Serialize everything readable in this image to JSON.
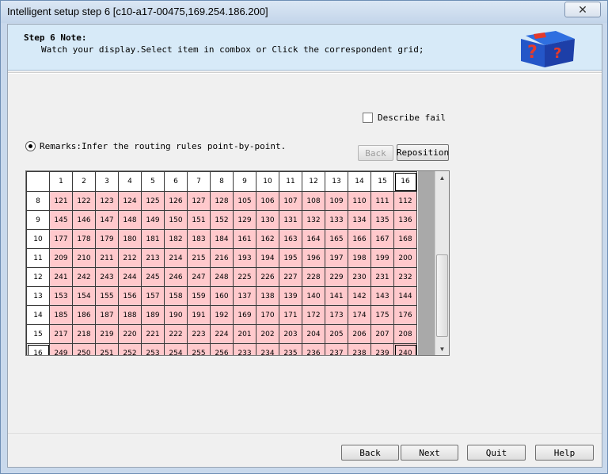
{
  "window": {
    "title": "Intelligent setup step 6 [c10-a17-00475,169.254.186.200]"
  },
  "note": {
    "title": "Step 6 Note:",
    "text": "Watch your display.Select item in combox or Click the correspondent grid;"
  },
  "describe_failure": {
    "label": "Describe fail",
    "checked": false
  },
  "remarks": {
    "label": "Remarks:Infer the routing rules point-by-point.",
    "selected": true
  },
  "grid_buttons": {
    "back_label": "Back",
    "reposition_label": "Reposition"
  },
  "grid": {
    "columns": [
      "1",
      "2",
      "3",
      "4",
      "5",
      "6",
      "7",
      "8",
      "9",
      "10",
      "11",
      "12",
      "13",
      "14",
      "15",
      "16"
    ],
    "rows": [
      {
        "label": "8",
        "cells": [
          "121",
          "122",
          "123",
          "124",
          "125",
          "126",
          "127",
          "128",
          "105",
          "106",
          "107",
          "108",
          "109",
          "110",
          "111",
          "112"
        ]
      },
      {
        "label": "9",
        "cells": [
          "145",
          "146",
          "147",
          "148",
          "149",
          "150",
          "151",
          "152",
          "129",
          "130",
          "131",
          "132",
          "133",
          "134",
          "135",
          "136"
        ]
      },
      {
        "label": "10",
        "cells": [
          "177",
          "178",
          "179",
          "180",
          "181",
          "182",
          "183",
          "184",
          "161",
          "162",
          "163",
          "164",
          "165",
          "166",
          "167",
          "168"
        ]
      },
      {
        "label": "11",
        "cells": [
          "209",
          "210",
          "211",
          "212",
          "213",
          "214",
          "215",
          "216",
          "193",
          "194",
          "195",
          "196",
          "197",
          "198",
          "199",
          "200"
        ]
      },
      {
        "label": "12",
        "cells": [
          "241",
          "242",
          "243",
          "244",
          "245",
          "246",
          "247",
          "248",
          "225",
          "226",
          "227",
          "228",
          "229",
          "230",
          "231",
          "232"
        ]
      },
      {
        "label": "13",
        "cells": [
          "153",
          "154",
          "155",
          "156",
          "157",
          "158",
          "159",
          "160",
          "137",
          "138",
          "139",
          "140",
          "141",
          "142",
          "143",
          "144"
        ]
      },
      {
        "label": "14",
        "cells": [
          "185",
          "186",
          "187",
          "188",
          "189",
          "190",
          "191",
          "192",
          "169",
          "170",
          "171",
          "172",
          "173",
          "174",
          "175",
          "176"
        ]
      },
      {
        "label": "15",
        "cells": [
          "217",
          "218",
          "219",
          "220",
          "221",
          "222",
          "223",
          "224",
          "201",
          "202",
          "203",
          "204",
          "205",
          "206",
          "207",
          "208"
        ]
      },
      {
        "label": "16",
        "cells": [
          "249",
          "250",
          "251",
          "252",
          "253",
          "254",
          "255",
          "256",
          "233",
          "234",
          "235",
          "236",
          "237",
          "238",
          "239",
          "240"
        ]
      }
    ],
    "cell_color": "#ffc9cc",
    "selected_column": "16",
    "selected_row": "16"
  },
  "footer": {
    "back_label": "Back",
    "next_label": "Next",
    "quit_label": "Quit",
    "help_label": "Help"
  },
  "icons": {
    "close": "close-icon",
    "logo": "cube-logo-icon",
    "scroll_up": "scroll-up-icon",
    "scroll_down": "scroll-down-icon"
  }
}
